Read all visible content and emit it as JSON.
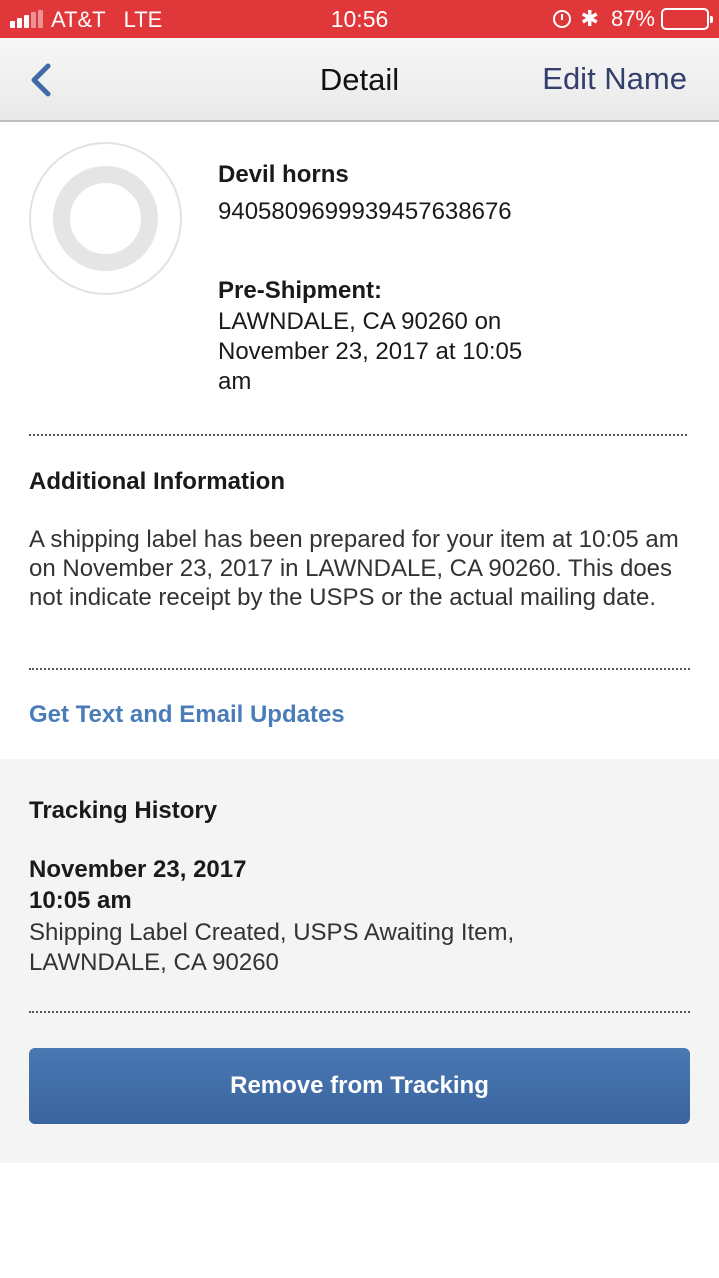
{
  "status_bar": {
    "carrier": "AT&T",
    "network": "LTE",
    "time": "10:56",
    "battery_percent": "87%",
    "battery_level": 0.87,
    "signal_bars_on": 3,
    "signal_bars_total": 5,
    "icons": [
      "alarm-icon",
      "bluetooth-icon",
      "battery-icon"
    ],
    "bluetooth_glyph": "✱"
  },
  "nav": {
    "back_icon": "chevron-left-icon",
    "title": "Detail",
    "edit_label": "Edit Name"
  },
  "item": {
    "name": "Devil horns",
    "tracking_number": "9405809699939457638676",
    "status_title": "Pre-Shipment:",
    "status_detail": "LAWNDALE, CA 90260 on November 23, 2017 at 10:05 am"
  },
  "additional": {
    "heading": "Additional Information",
    "text": "A shipping label has been prepared for your item at 10:05 am on November 23, 2017 in LAWNDALE, CA 90260. This does not indicate receipt by the USPS or the actual mailing date."
  },
  "updates_link": "Get Text and Email Updates",
  "history": {
    "heading": "Tracking History",
    "events": [
      {
        "date": "November 23, 2017",
        "time": "10:05 am",
        "description": "Shipping Label Created, USPS Awaiting Item, LAWNDALE, CA 90260"
      }
    ]
  },
  "remove_button": "Remove from Tracking",
  "colors": {
    "status_bar": "#e0383a",
    "link": "#4a7db8",
    "nav_action": "#34406b",
    "button": "#3f6ca8"
  }
}
